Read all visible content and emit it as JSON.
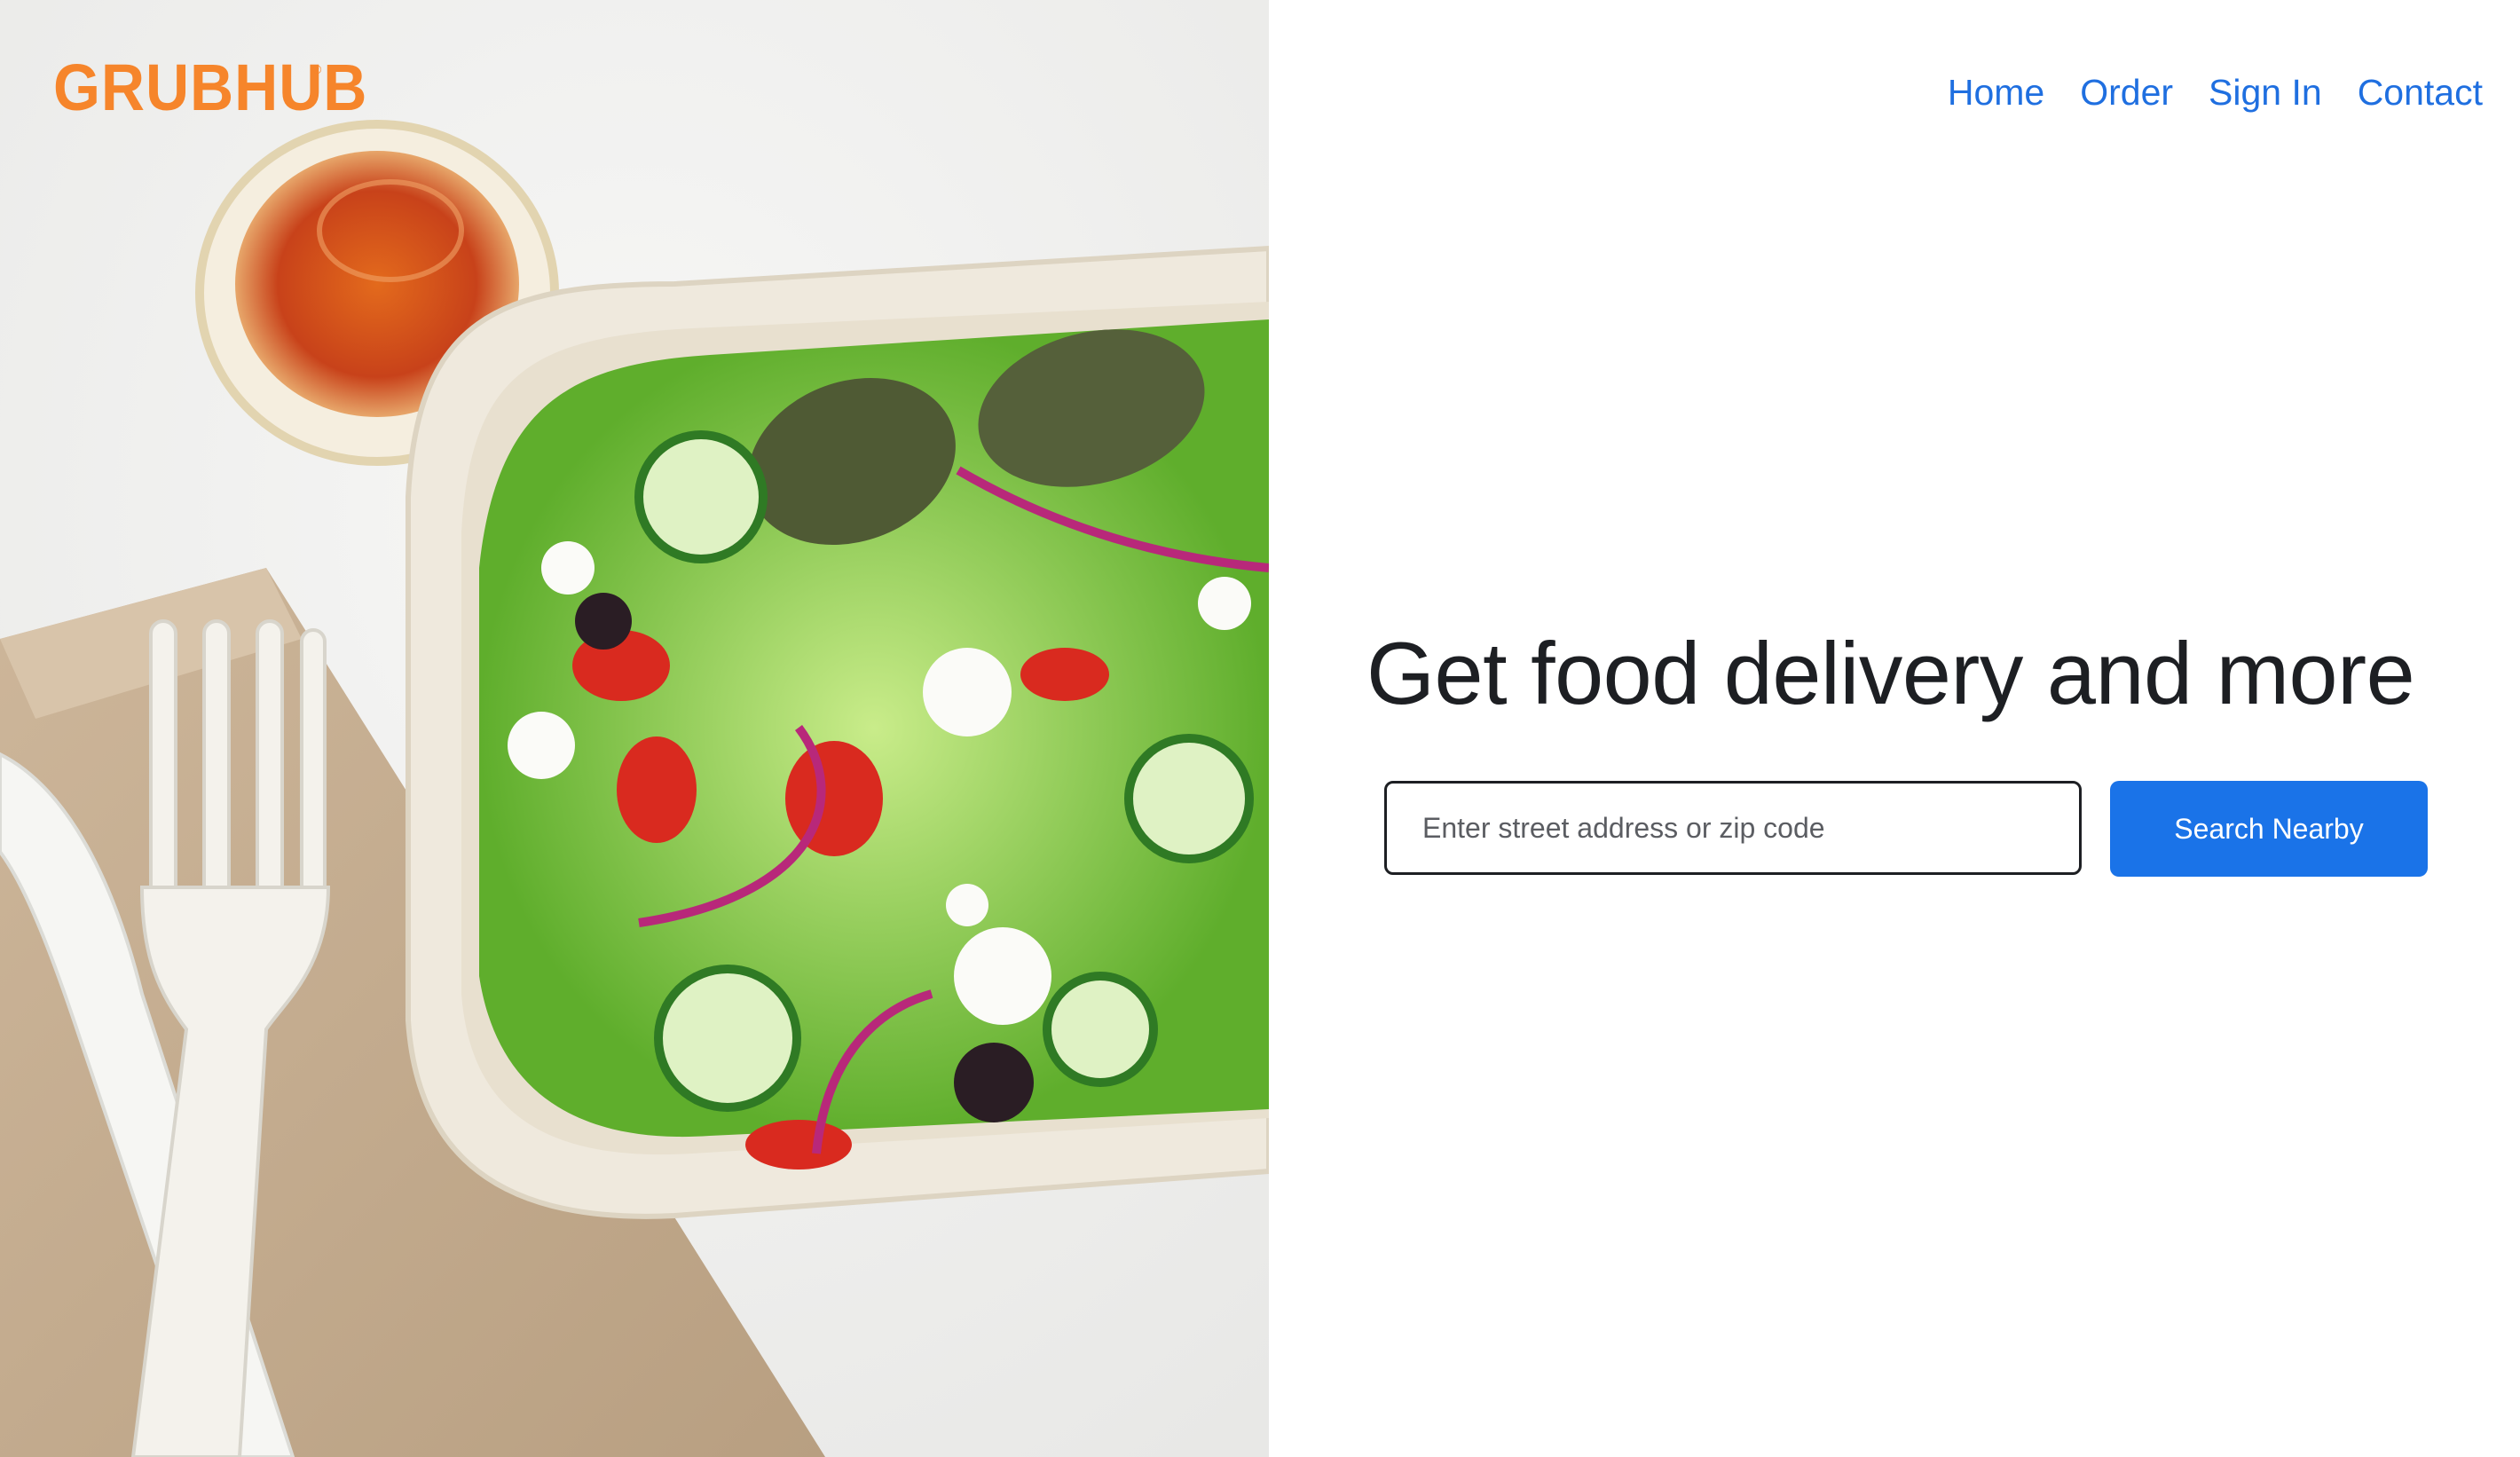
{
  "brand": {
    "logo_text": "GRUBHUB",
    "trademark": "®",
    "color": "#f6852b"
  },
  "nav": {
    "items": [
      {
        "label": "Home"
      },
      {
        "label": "Order"
      },
      {
        "label": "Sign In"
      },
      {
        "label": "Contact"
      }
    ],
    "link_color": "#1f6fe0"
  },
  "hero": {
    "headline": "Get food delivery and more",
    "image_icon": "salad-photo"
  },
  "search": {
    "placeholder": "Enter street address or zip code",
    "value": "",
    "button_label": "Search Nearby",
    "button_color": "#1a73e8"
  }
}
